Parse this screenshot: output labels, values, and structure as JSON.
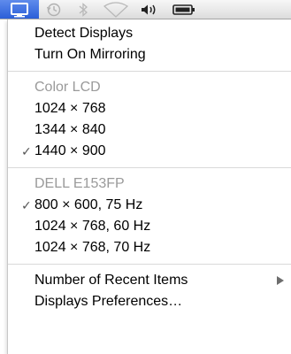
{
  "menubar": {
    "icons": [
      "display-icon",
      "time-machine-icon",
      "bluetooth-icon",
      "wifi-icon",
      "volume-icon",
      "battery-icon"
    ],
    "accent_color": "#3a6ee0"
  },
  "menu": {
    "actions": [
      {
        "label": "Detect Displays"
      },
      {
        "label": "Turn On Mirroring"
      }
    ],
    "color_lcd": {
      "header": "Color LCD",
      "items": [
        {
          "label": "1024 × 768",
          "checked": false
        },
        {
          "label": "1344 × 840",
          "checked": false
        },
        {
          "label": "1440 × 900",
          "checked": true
        }
      ]
    },
    "dell": {
      "header": "DELL E153FP",
      "items": [
        {
          "label": "800 × 600, 75 Hz",
          "checked": true
        },
        {
          "label": "1024 × 768, 60 Hz",
          "checked": false
        },
        {
          "label": "1024 × 768, 70 Hz",
          "checked": false
        }
      ]
    },
    "footer": [
      {
        "label": "Number of Recent Items",
        "submenu": true
      },
      {
        "label": "Displays Preferences…",
        "submenu": false
      }
    ],
    "check_mark": "✓"
  }
}
